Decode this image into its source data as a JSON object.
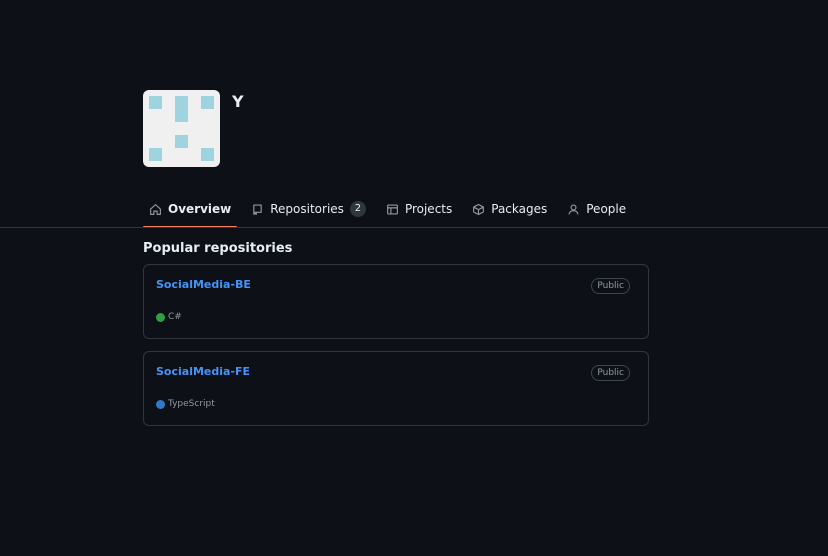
{
  "org": {
    "name": "Y"
  },
  "nav": {
    "items": [
      {
        "label": "Overview",
        "icon": "home-icon",
        "selected": true
      },
      {
        "label": "Repositories",
        "icon": "repo-icon",
        "count": "2"
      },
      {
        "label": "Projects",
        "icon": "table-icon"
      },
      {
        "label": "Packages",
        "icon": "package-icon"
      },
      {
        "label": "People",
        "icon": "person-icon"
      }
    ]
  },
  "popular": {
    "title": "Popular repositories",
    "repos": [
      {
        "name": "SocialMedia-BE",
        "visibility": "Public",
        "language": "C#",
        "language_color": "#2ea043"
      },
      {
        "name": "SocialMedia-FE",
        "visibility": "Public",
        "language": "TypeScript",
        "language_color": "#3178c6"
      }
    ]
  },
  "colors": {
    "accent_underline": "#f78166",
    "link": "#4493f8",
    "background": "#0d1117",
    "border": "#30363d"
  }
}
